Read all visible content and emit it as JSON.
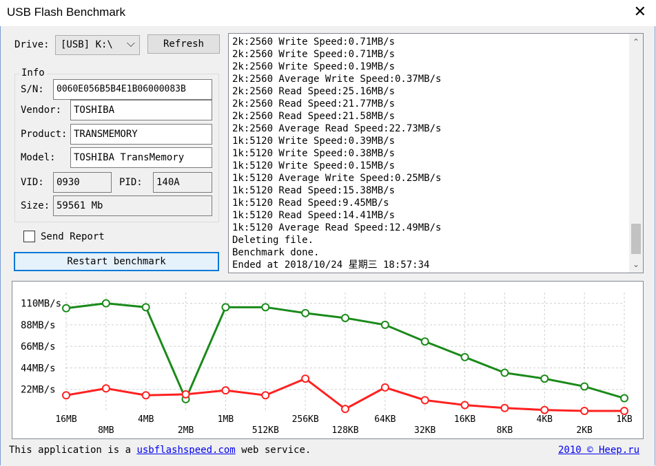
{
  "window": {
    "title": "USB Flash Benchmark",
    "close_glyph": "✕"
  },
  "drive": {
    "label": "Drive:",
    "value": "[USB] K:\\",
    "chevron": "⌵"
  },
  "refresh_label": "Refresh",
  "info": {
    "group_label": "Info",
    "sn_label": "S/N:",
    "sn": "0060E056B5B4E1B06000083B",
    "vendor_label": "Vendor:",
    "vendor": "TOSHIBA",
    "product_label": "Product:",
    "product": "TRANSMEMORY",
    "model_label": "Model:",
    "model": "TOSHIBA TransMemory",
    "vid_label": "VID:",
    "vid": "0930",
    "pid_label": "PID:",
    "pid": "140A",
    "size_label": "Size:",
    "size": "59561 Mb"
  },
  "send_report_label": "Send Report",
  "restart_label": "Restart benchmark",
  "log": {
    "lines": [
      "2k:2560 Write Speed:0.71MB/s",
      "2k:2560 Write Speed:0.71MB/s",
      "2k:2560 Write Speed:0.19MB/s",
      "2k:2560 Average Write Speed:0.37MB/s",
      "2k:2560 Read Speed:25.16MB/s",
      "2k:2560 Read Speed:21.77MB/s",
      "2k:2560 Read Speed:21.58MB/s",
      "2k:2560 Average Read Speed:22.73MB/s",
      "1k:5120 Write Speed:0.39MB/s",
      "1k:5120 Write Speed:0.38MB/s",
      "1k:5120 Write Speed:0.15MB/s",
      "1k:5120 Average Write Speed:0.25MB/s",
      "1k:5120 Read Speed:15.38MB/s",
      "1k:5120 Read Speed:9.45MB/s",
      "1k:5120 Read Speed:14.41MB/s",
      "1k:5120 Average Read Speed:12.49MB/s",
      "Deleting file.",
      "Benchmark done.",
      "Ended at 2018/10/24 星期三 18:57:34"
    ],
    "up_glyph": "⌃",
    "down_glyph": "⌄"
  },
  "chart_data": {
    "type": "line",
    "categories": [
      "16MB",
      "8MB",
      "4MB",
      "2MB",
      "1MB",
      "512KB",
      "256KB",
      "128KB",
      "64KB",
      "32KB",
      "16KB",
      "8KB",
      "4KB",
      "2KB",
      "1KB"
    ],
    "y_tick_labels": [
      "110MB/s",
      "88MB/s",
      "66MB/s",
      "44MB/s",
      "22MB/s"
    ],
    "y_ticks": [
      110,
      88,
      66,
      44,
      22
    ],
    "ylim": [
      0,
      121
    ],
    "grid": true,
    "series": [
      {
        "color": "#1a8a1a",
        "values": [
          105,
          110,
          106,
          12,
          106,
          106,
          100,
          95,
          88,
          71,
          55,
          39,
          33,
          25,
          13
        ]
      },
      {
        "color": "#ff2020",
        "values": [
          16,
          23,
          16,
          17,
          21,
          16,
          33,
          2,
          24,
          11,
          6,
          3,
          1,
          0,
          0
        ]
      }
    ]
  },
  "footer": {
    "prefix": "This application is a ",
    "link": "usbflashspeed.com",
    "suffix": " web service.",
    "right_link": "2010 © Heep.ru"
  }
}
